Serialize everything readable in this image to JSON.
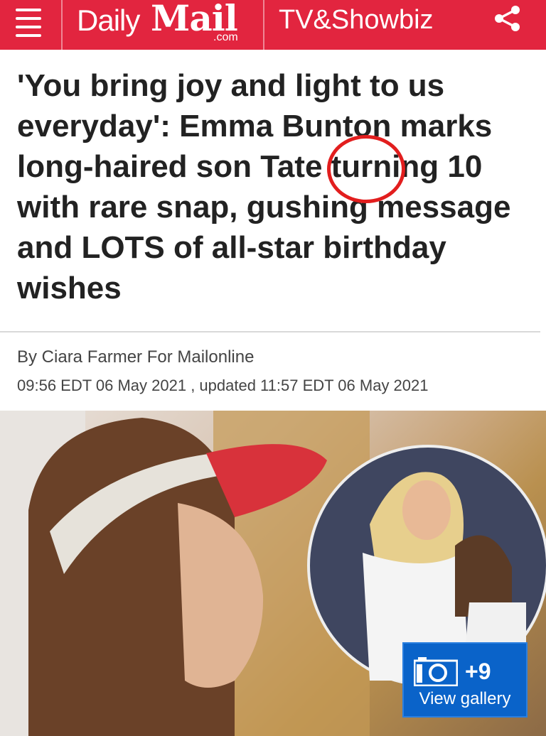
{
  "header": {
    "brand_daily": "Daily",
    "brand_mail": "Mail",
    "brand_com": ".com",
    "section": "TV&Showbiz"
  },
  "article": {
    "headline": "'You bring joy and light to us everyday': Emma Bunton marks long-haired son Tate turning 10 with rare snap, gushing message and LOTS of all-star birthday wishes",
    "byline": "By Ciara Farmer For Mailonline",
    "dateline": "09:56 EDT 06 May 2021 , updated 11:57 EDT 06 May 2021"
  },
  "gallery": {
    "count": "+9",
    "label": "View gallery"
  },
  "colors": {
    "brand_red": "#e2253f",
    "gallery_blue": "#0a63c9",
    "annotation_red": "#e21e1e"
  },
  "icons": [
    "menu-icon",
    "share-icon",
    "camera-icon"
  ]
}
